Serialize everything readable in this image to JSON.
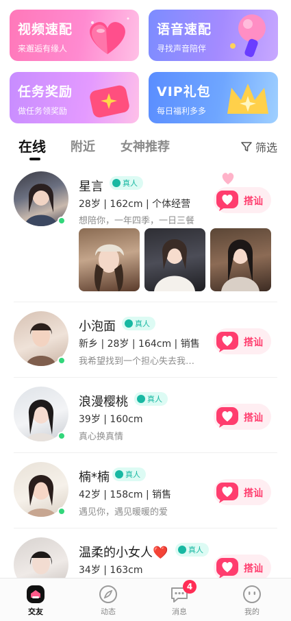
{
  "feature_cards": [
    {
      "title": "视频速配",
      "subtitle": "来邂逅有缘人"
    },
    {
      "title": "语音速配",
      "subtitle": "寻找声音陪伴"
    },
    {
      "title": "任务奖励",
      "subtitle": "做任务领奖励"
    },
    {
      "title": "VIP礼包",
      "subtitle": "每日福利多多"
    }
  ],
  "tabs": [
    {
      "label": "在线"
    },
    {
      "label": "附近"
    },
    {
      "label": "女神推荐"
    }
  ],
  "filter_label": "筛选",
  "verified_label": "真人",
  "chat_button_label": "搭讪",
  "users": [
    {
      "name": "星言",
      "info": "28岁 | 162cm | 个体经营",
      "bio": "想陪你，一年四季，一日三餐"
    },
    {
      "name": "小泡面",
      "info": "新乡 | 28岁 | 164cm | 销售",
      "bio": "我希望找到一个担心失去我…"
    },
    {
      "name": "浪漫樱桃",
      "info": "39岁 | 160cm",
      "bio": "真心换真情"
    },
    {
      "name": "楠*楠",
      "info": "42岁 | 158cm | 销售",
      "bio": "遇见你，遇见暖暖的爱"
    },
    {
      "name": "温柔的小女人❤️",
      "info": "34岁 | 163cm",
      "bio": ""
    }
  ],
  "bottom_nav": [
    {
      "label": "交友"
    },
    {
      "label": "动态"
    },
    {
      "label": "消息",
      "badge": "4"
    },
    {
      "label": "我的"
    }
  ]
}
